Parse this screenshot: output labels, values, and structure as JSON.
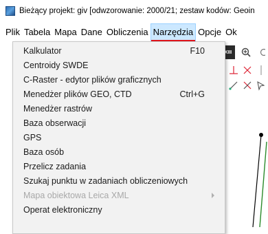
{
  "window": {
    "title": "Bieżący projekt: giv [odwzorowanie: 2000/21; zestaw kodów: Geoin"
  },
  "menubar": {
    "items": [
      {
        "label": "Plik"
      },
      {
        "label": "Tabela"
      },
      {
        "label": "Mapa"
      },
      {
        "label": "Dane"
      },
      {
        "label": "Obliczenia"
      },
      {
        "label": "Narzędzia"
      },
      {
        "label": "Opcje"
      },
      {
        "label": "Ok"
      }
    ],
    "active_index": 5
  },
  "toolbar": {
    "dark_button_label": "XIII"
  },
  "dropdown": {
    "items": [
      {
        "label": "Kalkulator",
        "shortcut": "F10",
        "enabled": true,
        "submenu": false
      },
      {
        "label": "Centroidy SWDE",
        "shortcut": "",
        "enabled": true,
        "submenu": false
      },
      {
        "label": "C-Raster - edytor plików graficznych",
        "shortcut": "",
        "enabled": true,
        "submenu": false
      },
      {
        "label": "Menedżer plików GEO, CTD",
        "shortcut": "Ctrl+G",
        "enabled": true,
        "submenu": false
      },
      {
        "label": "Menedżer rastrów",
        "shortcut": "",
        "enabled": true,
        "submenu": false
      },
      {
        "label": "Baza obserwacji",
        "shortcut": "",
        "enabled": true,
        "submenu": false
      },
      {
        "label": "GPS",
        "shortcut": "",
        "enabled": true,
        "submenu": false
      },
      {
        "label": "Baza osób",
        "shortcut": "",
        "enabled": true,
        "submenu": false
      },
      {
        "label": "Przelicz zadania",
        "shortcut": "",
        "enabled": true,
        "submenu": false
      },
      {
        "label": "Szukaj punktu w zadaniach obliczeniowych",
        "shortcut": "",
        "enabled": true,
        "submenu": false
      },
      {
        "label": "Mapa obiektowa Leica XML",
        "shortcut": "",
        "enabled": false,
        "submenu": true
      },
      {
        "label": "Operat elektroniczny",
        "shortcut": "",
        "enabled": true,
        "submenu": false
      }
    ]
  }
}
